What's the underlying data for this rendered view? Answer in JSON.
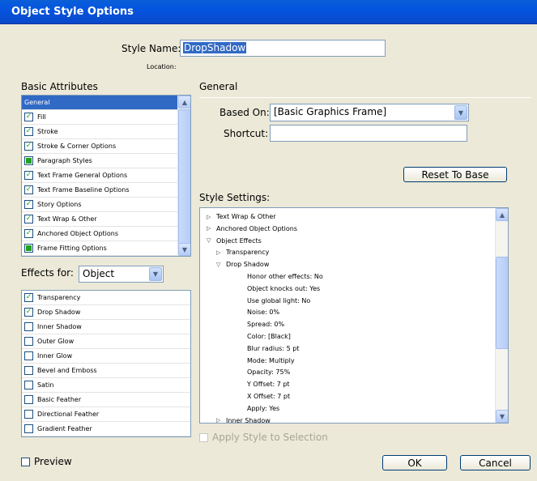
{
  "window": {
    "title": "Object Style Options"
  },
  "style_name": {
    "label": "Style Name:",
    "value": "DropShadow"
  },
  "location": {
    "label": "Location:"
  },
  "basic_attributes": {
    "heading": "Basic Attributes",
    "items": [
      {
        "label": "General",
        "check": "none",
        "selected": true
      },
      {
        "label": "Fill",
        "check": "checked"
      },
      {
        "label": "Stroke",
        "check": "checked"
      },
      {
        "label": "Stroke & Corner Options",
        "check": "checked"
      },
      {
        "label": "Paragraph Styles",
        "check": "partial"
      },
      {
        "label": "Text Frame General Options",
        "check": "checked"
      },
      {
        "label": "Text Frame Baseline Options",
        "check": "checked"
      },
      {
        "label": "Story Options",
        "check": "checked"
      },
      {
        "label": "Text Wrap & Other",
        "check": "checked"
      },
      {
        "label": "Anchored Object Options",
        "check": "checked"
      },
      {
        "label": "Frame Fitting Options",
        "check": "partial"
      }
    ]
  },
  "effects_for": {
    "label": "Effects for:",
    "value": "Object"
  },
  "effects": {
    "items": [
      {
        "label": "Transparency",
        "check": "checked"
      },
      {
        "label": "Drop Shadow",
        "check": "checked"
      },
      {
        "label": "Inner Shadow",
        "check": "unchecked"
      },
      {
        "label": "Outer Glow",
        "check": "unchecked"
      },
      {
        "label": "Inner Glow",
        "check": "unchecked"
      },
      {
        "label": "Bevel and Emboss",
        "check": "unchecked"
      },
      {
        "label": "Satin",
        "check": "unchecked"
      },
      {
        "label": "Basic Feather",
        "check": "unchecked"
      },
      {
        "label": "Directional Feather",
        "check": "unchecked"
      },
      {
        "label": "Gradient Feather",
        "check": "unchecked"
      }
    ]
  },
  "general": {
    "heading": "General",
    "based_on": {
      "label": "Based On:",
      "value": "[Basic Graphics Frame]"
    },
    "shortcut": {
      "label": "Shortcut:",
      "value": ""
    },
    "reset_button": "Reset To Base"
  },
  "style_settings": {
    "heading": "Style Settings:",
    "rows": [
      {
        "text": "Text Wrap & Other",
        "level": 0,
        "toggle": "collapsed"
      },
      {
        "text": "Anchored Object Options",
        "level": 0,
        "toggle": "collapsed"
      },
      {
        "text": "Object Effects",
        "level": 0,
        "toggle": "expanded"
      },
      {
        "text": "Transparency",
        "level": 1,
        "toggle": "collapsed"
      },
      {
        "text": "Drop Shadow",
        "level": 1,
        "toggle": "expanded"
      },
      {
        "text": "Honor other effects: No",
        "level": 2,
        "toggle": "none"
      },
      {
        "text": "Object knocks out: Yes",
        "level": 2,
        "toggle": "none"
      },
      {
        "text": "Use global light: No",
        "level": 2,
        "toggle": "none"
      },
      {
        "text": "Noise: 0%",
        "level": 2,
        "toggle": "none"
      },
      {
        "text": "Spread: 0%",
        "level": 2,
        "toggle": "none"
      },
      {
        "text": "Color: [Black]",
        "level": 2,
        "toggle": "none"
      },
      {
        "text": "Blur radius: 5 pt",
        "level": 2,
        "toggle": "none"
      },
      {
        "text": "Mode: Multiply",
        "level": 2,
        "toggle": "none"
      },
      {
        "text": "Opacity: 75%",
        "level": 2,
        "toggle": "none"
      },
      {
        "text": "Y Offset: 7 pt",
        "level": 2,
        "toggle": "none"
      },
      {
        "text": "X Offset: 7 pt",
        "level": 2,
        "toggle": "none"
      },
      {
        "text": "Apply: Yes",
        "level": 2,
        "toggle": "none"
      },
      {
        "text": "Inner Shadow",
        "level": 1,
        "toggle": "collapsed"
      }
    ]
  },
  "apply_style": {
    "label": "Apply Style to Selection",
    "enabled": false
  },
  "preview": {
    "label": "Preview"
  },
  "buttons": {
    "ok": "OK",
    "cancel": "Cancel"
  },
  "colors": {
    "title_bar": "#0454E0",
    "selection": "#316AC5",
    "dialog_bg": "#ECE9D8",
    "check": "#21A121"
  }
}
